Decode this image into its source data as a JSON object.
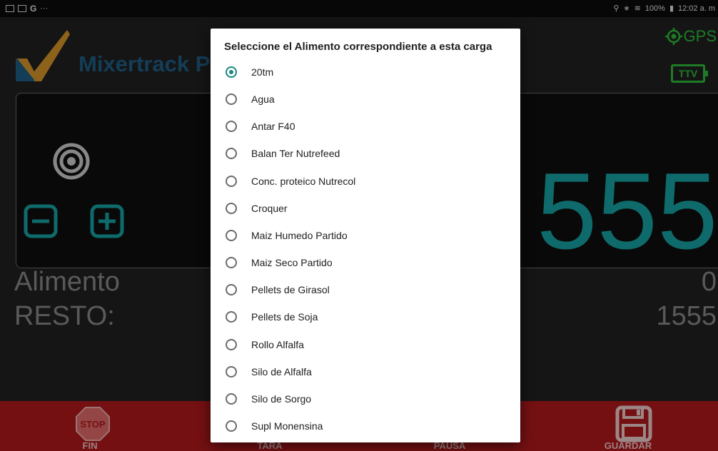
{
  "status_bar": {
    "icons": [
      "image-icon",
      "gallery-icon"
    ],
    "g_letter": "G",
    "overflow": "···",
    "right_text": "100%",
    "time": "12:02 a. m"
  },
  "header": {
    "brand": "Mixertrack P",
    "gps_label": "GPS",
    "ttv_label": "TTV",
    "accent": "#17a5a5",
    "brand_color": "#1f5e86",
    "status_green": "#2fbf3a"
  },
  "main": {
    "weight_value": "555",
    "alimento_label": "Alimento",
    "alimento_value": "0",
    "resto_label": "RESTO:",
    "resto_value": "1555"
  },
  "bottom_bar": {
    "fin_label": "FIN",
    "stop_text": "STOP",
    "tara_label": "TARA",
    "pausa_label": "PAUSA",
    "guardar_label": "GUARDAR",
    "color": "#b3191c"
  },
  "dialog": {
    "title": "Seleccione el Alimento correspondiente a esta carga",
    "selected_index": 0,
    "options": [
      "20tm",
      "Agua",
      "Antar F40",
      "Balan Ter Nutrefeed",
      "Conc. proteico Nutrecol",
      "Croquer",
      "Maiz Humedo Partido",
      "Maiz Seco Partido",
      "Pellets de Girasol",
      "Pellets de Soja",
      "Rollo Alfalfa",
      "Silo de Alfalfa",
      "Silo de Sorgo",
      "Supl Monensina"
    ]
  }
}
